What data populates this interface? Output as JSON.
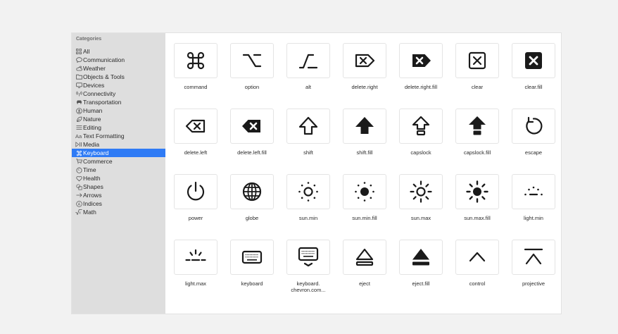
{
  "sidebar": {
    "heading": "Categories",
    "items": [
      {
        "label": "All",
        "icon": "grid-icon"
      },
      {
        "label": "Communication",
        "icon": "speech-bubble-icon"
      },
      {
        "label": "Weather",
        "icon": "cloud-sun-icon"
      },
      {
        "label": "Objects & Tools",
        "icon": "folder-icon"
      },
      {
        "label": "Devices",
        "icon": "display-icon"
      },
      {
        "label": "Connectivity",
        "icon": "antenna-icon"
      },
      {
        "label": "Transportation",
        "icon": "car-icon"
      },
      {
        "label": "Human",
        "icon": "person-circle-icon"
      },
      {
        "label": "Nature",
        "icon": "leaf-icon"
      },
      {
        "label": "Editing",
        "icon": "slider-lines-icon"
      },
      {
        "label": "Text Formatting",
        "icon": "text-aa-icon"
      },
      {
        "label": "Media",
        "icon": "play-pause-icon"
      },
      {
        "label": "Keyboard",
        "icon": "command-icon",
        "selected": true
      },
      {
        "label": "Commerce",
        "icon": "cart-icon"
      },
      {
        "label": "Time",
        "icon": "timer-icon"
      },
      {
        "label": "Health",
        "icon": "heart-icon"
      },
      {
        "label": "Shapes",
        "icon": "shapes-icon"
      },
      {
        "label": "Arrows",
        "icon": "arrow-right-icon"
      },
      {
        "label": "Indices",
        "icon": "circled-a-icon"
      },
      {
        "label": "Math",
        "icon": "square-root-icon"
      }
    ]
  },
  "symbols": [
    {
      "name": "command",
      "icon": "command-icon"
    },
    {
      "name": "option",
      "icon": "option-key-icon"
    },
    {
      "name": "alt",
      "icon": "alt-key-icon"
    },
    {
      "name": "delete.right",
      "icon": "delete-right-icon"
    },
    {
      "name": "delete.right.fill",
      "icon": "delete-right-fill-icon"
    },
    {
      "name": "clear",
      "icon": "clear-icon"
    },
    {
      "name": "clear.fill",
      "icon": "clear-fill-icon"
    },
    {
      "name": "delete.left",
      "icon": "delete-left-icon"
    },
    {
      "name": "delete.left.fill",
      "icon": "delete-left-fill-icon"
    },
    {
      "name": "shift",
      "icon": "shift-icon"
    },
    {
      "name": "shift.fill",
      "icon": "shift-fill-icon"
    },
    {
      "name": "capslock",
      "icon": "capslock-icon"
    },
    {
      "name": "capslock.fill",
      "icon": "capslock-fill-icon"
    },
    {
      "name": "escape",
      "icon": "escape-icon"
    },
    {
      "name": "power",
      "icon": "power-icon"
    },
    {
      "name": "globe",
      "icon": "globe-icon"
    },
    {
      "name": "sun.min",
      "icon": "sun-min-icon"
    },
    {
      "name": "sun.min.fill",
      "icon": "sun-min-fill-icon"
    },
    {
      "name": "sun.max",
      "icon": "sun-max-icon"
    },
    {
      "name": "sun.max.fill",
      "icon": "sun-max-fill-icon"
    },
    {
      "name": "light.min",
      "icon": "light-min-icon"
    },
    {
      "name": "light.max",
      "icon": "light-max-icon"
    },
    {
      "name": "keyboard",
      "icon": "keyboard-icon"
    },
    {
      "name": "keyboard.\nchevron.com...",
      "icon": "keyboard-chevron-compact-down-icon"
    },
    {
      "name": "eject",
      "icon": "eject-icon"
    },
    {
      "name": "eject.fill",
      "icon": "eject-fill-icon"
    },
    {
      "name": "control",
      "icon": "control-icon"
    },
    {
      "name": "projective",
      "icon": "projective-icon"
    }
  ],
  "colors": {
    "selection": "#2f7bf5",
    "sidebar_bg": "#dedede",
    "icon": "#1a1a1a"
  }
}
